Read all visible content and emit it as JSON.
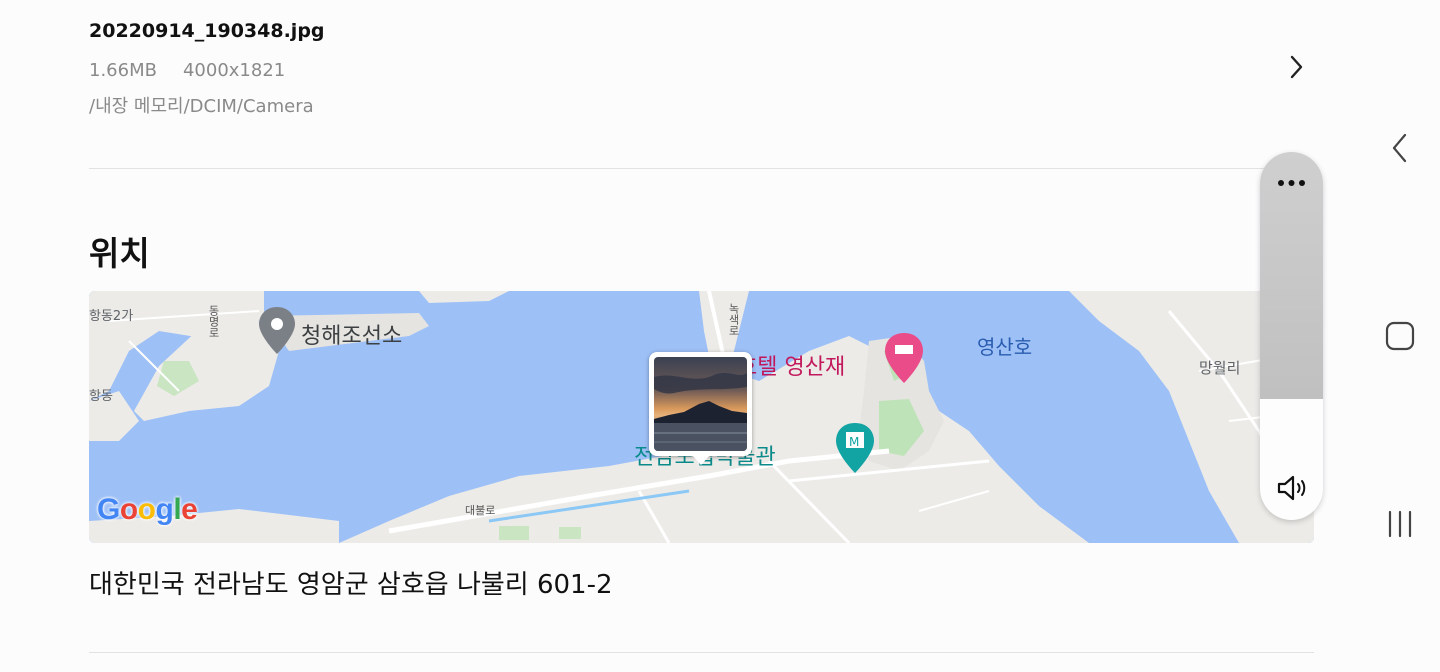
{
  "file": {
    "name": "20220914_190348.jpg",
    "size": "1.66MB",
    "resolution": "4000x1821",
    "path": "/내장 메모리/DCIM/Camera"
  },
  "location": {
    "section_title": "위치",
    "address": "대한민국 전라남도 영암군 삼호읍 나불리 601-2",
    "map": {
      "labels": {
        "district1": "항동2가",
        "district2": "항동",
        "road1": "동명로",
        "road2": "녹색로",
        "road3": "대불로",
        "place": "청해조선소",
        "hotel": "호텔 영산재",
        "museum": "전남도립박물관",
        "lake": "영산호",
        "village": "망월리"
      },
      "google_logo": "Google"
    }
  },
  "volume": {
    "level_percent": 67
  },
  "icons": {
    "detail": "chevron-right-icon",
    "more": "more-horizontal-icon",
    "speaker": "speaker-icon",
    "nav_back": "nav-back-icon",
    "nav_home": "nav-home-icon",
    "nav_recents": "nav-recents-icon"
  }
}
